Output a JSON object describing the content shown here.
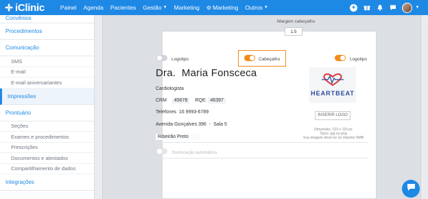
{
  "app": {
    "name": "iClinic"
  },
  "nav": {
    "items": [
      "Painel",
      "Agenda",
      "Pacientes",
      "Gestão",
      "Marketing",
      "Marketing",
      "Outros"
    ]
  },
  "sidebar": {
    "items": [
      {
        "label": "Convênios"
      },
      {
        "label": "Procedimentos"
      },
      {
        "label": "Comunicação"
      },
      {
        "label": "SMS"
      },
      {
        "label": "E-mail"
      },
      {
        "label": "E-mail aniversariantes"
      },
      {
        "label": "Impressões"
      },
      {
        "label": "Prontuário"
      },
      {
        "label": "Seções"
      },
      {
        "label": "Exames e procedimentos"
      },
      {
        "label": "Prescrições"
      },
      {
        "label": "Documentos e atestados"
      },
      {
        "label": "Compartilhamento de dados"
      },
      {
        "label": "Integrações"
      }
    ]
  },
  "header_settings": {
    "margin_label": "Margem cabeçalho",
    "margin_value": "1.5",
    "toggle_logo_left": {
      "label": "Logotipo",
      "on": false
    },
    "toggle_header": {
      "label": "Cabeçalho",
      "on": true
    },
    "toggle_logo_right": {
      "label": "Logotipo",
      "on": true
    }
  },
  "doctor": {
    "prefix": "Dra.",
    "name": "Maria Fonsceca",
    "specialty": "Cardiologista",
    "crm_label": "CRM",
    "crm_value": "45678",
    "rqe_label": "RQE:",
    "rqe_value": "46397",
    "phone_label": "Telefones",
    "phone_value": "16 9993-6789",
    "address": "Avenida Gonçalves 396",
    "address_sep": "-",
    "address_suite": "Sala 5",
    "city": "Ribeirão Preto"
  },
  "logo_panel": {
    "brand": "HEARTBEAT",
    "insert_button": "INSERIR LOGO",
    "note_lines": [
      "Dimensão: 223 x 115 px",
      "Tipos: jpg ou png",
      "Sua imagem deve ter no máximo 5MB"
    ]
  },
  "auto_numbering": {
    "label": "Numeração automática",
    "on": false
  },
  "colors": {
    "primary": "#1e88e5",
    "accent": "#f28b1a"
  }
}
